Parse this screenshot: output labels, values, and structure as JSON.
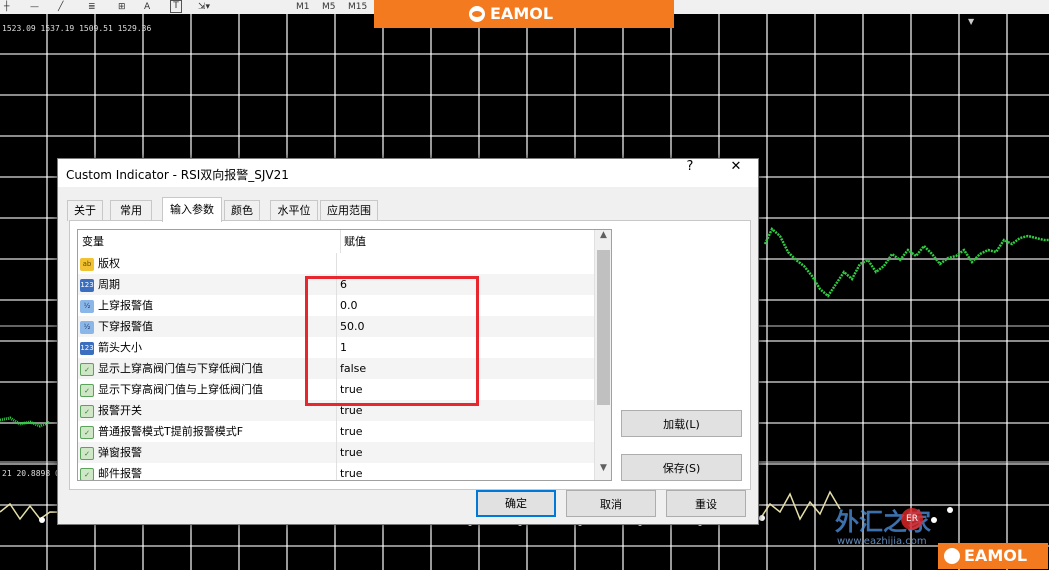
{
  "toolbar": {
    "letter_tool": "A",
    "text_tool": "T",
    "periods": [
      "M1",
      "M5",
      "M15"
    ]
  },
  "banner": {
    "logo_text": "EAMOL"
  },
  "chart": {
    "price_readout": "1523.09 1537.19 1509.51 1529.36",
    "rsi_readout": "21 20.8898 0"
  },
  "dialog": {
    "title": "Custom Indicator - RSI双向报警_SJV21",
    "help_label": "?",
    "close_label": "✕",
    "tabs": [
      {
        "label": "关于",
        "active": false
      },
      {
        "label": "常用",
        "active": false
      },
      {
        "label": "输入参数",
        "active": true
      },
      {
        "label": "颜色",
        "active": false
      },
      {
        "label": "水平位",
        "active": false
      },
      {
        "label": "应用范围",
        "active": false
      }
    ],
    "columns": {
      "variable": "变量",
      "value": "赋值"
    },
    "rows": [
      {
        "icon": "ab",
        "name": "版权",
        "value": ""
      },
      {
        "icon": "123",
        "name": "周期",
        "value": "6"
      },
      {
        "icon": "12",
        "name": "上穿报警值",
        "value": "0.0"
      },
      {
        "icon": "12",
        "name": "下穿报警值",
        "value": "50.0"
      },
      {
        "icon": "123",
        "name": "箭头大小",
        "value": "1"
      },
      {
        "icon": "bool",
        "name": "显示上穿高阀门值与下穿低阀门值",
        "value": "false"
      },
      {
        "icon": "bool",
        "name": "显示下穿高阀门值与上穿低阀门值",
        "value": "true"
      },
      {
        "icon": "bool",
        "name": "报警开关",
        "value": "true"
      },
      {
        "icon": "bool",
        "name": "普通报警模式T提前报警模式F",
        "value": "true"
      },
      {
        "icon": "bool",
        "name": "弹窗报警",
        "value": "true"
      },
      {
        "icon": "bool",
        "name": "邮件报警",
        "value": "true"
      }
    ],
    "icon_labels": {
      "ab": "ab",
      "123": "123",
      "12": "½",
      "bool": "✓"
    },
    "load_button": "加载(L)",
    "save_button": "保存(S)",
    "ok_button": "确定",
    "cancel_button": "取消",
    "reset_button": "重设"
  },
  "watermark": {
    "site_name": "外汇之家",
    "url": "www.eazhijia.com",
    "logo_text": "EAMOL"
  },
  "colors": {
    "accent": "#0078d7",
    "highlight": "#e8262d",
    "banner": "#f47a1f",
    "candles_up": "#2ecc40",
    "rsi_line": "#e6dfa8"
  }
}
